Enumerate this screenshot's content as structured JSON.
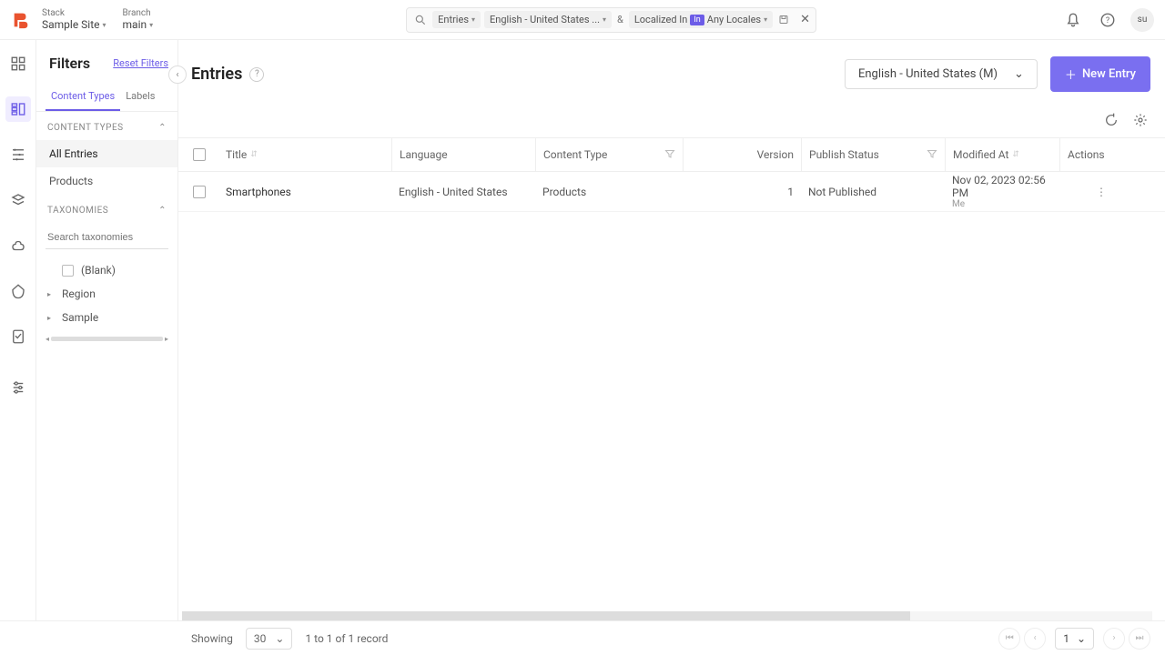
{
  "topbar": {
    "stack_label": "Stack",
    "stack_value": "Sample Site",
    "branch_label": "Branch",
    "branch_value": "main",
    "search": {
      "scope": "Entries",
      "language": "English - United States ...",
      "amp": "&",
      "localized_label": "Localized In",
      "localized_badge": "In",
      "localized_value": "Any Locales"
    },
    "user_initials": "su"
  },
  "filters": {
    "title": "Filters",
    "reset": "Reset Filters",
    "tabs": {
      "content_types": "Content Types",
      "labels": "Labels"
    },
    "ct_section": "CONTENT TYPES",
    "ct_items": [
      "All Entries",
      "Products"
    ],
    "tax_section": "TAXONOMIES",
    "tax_search_placeholder": "Search taxonomies",
    "tax_items": [
      "(Blank)",
      "Region",
      "Sample"
    ]
  },
  "page": {
    "title": "Entries",
    "language_selector": "English - United States (M)",
    "new_entry": "New Entry"
  },
  "table": {
    "columns": {
      "title": "Title",
      "language": "Language",
      "content_type": "Content Type",
      "version": "Version",
      "publish_status": "Publish Status",
      "modified_at": "Modified At",
      "actions": "Actions"
    },
    "rows": [
      {
        "title": "Smartphones",
        "language": "English - United States",
        "content_type": "Products",
        "version": "1",
        "publish_status": "Not Published",
        "modified_at": "Nov 02, 2023 02:56 PM",
        "modified_by": "Me"
      }
    ]
  },
  "footer": {
    "showing": "Showing",
    "page_size": "30",
    "summary": "1 to 1 of 1 record",
    "page_num": "1"
  }
}
